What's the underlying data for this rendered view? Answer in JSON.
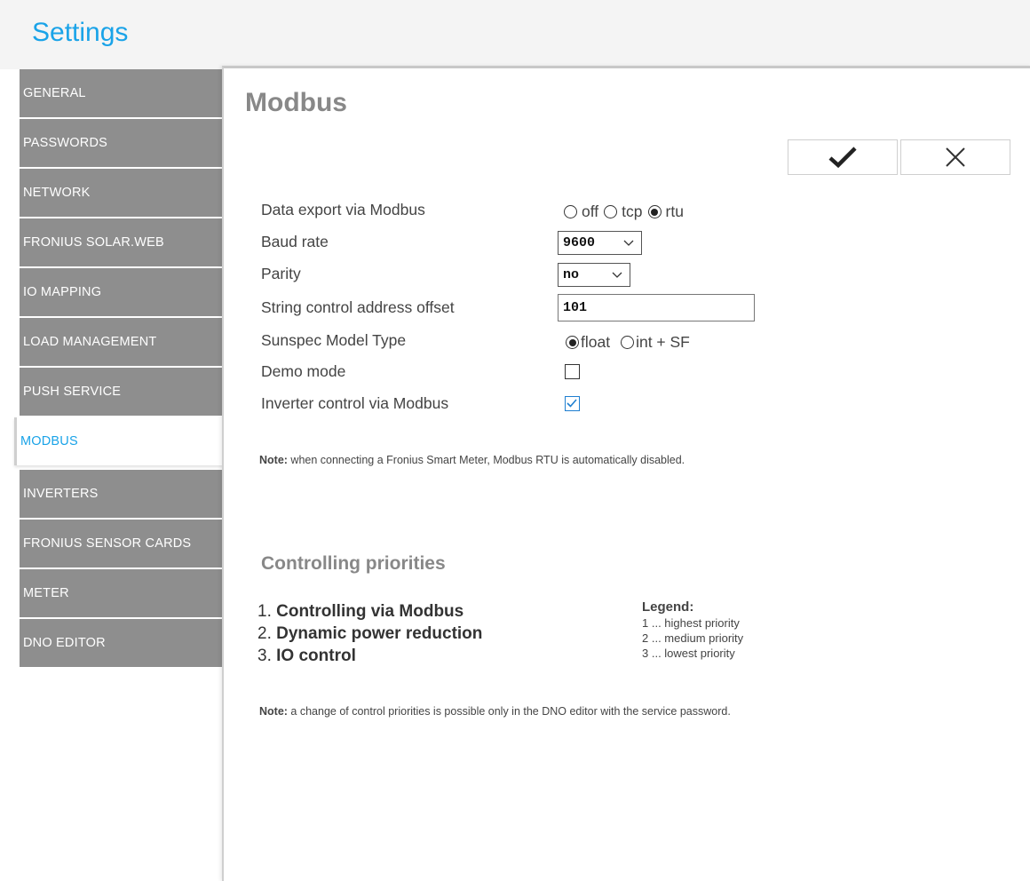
{
  "app": {
    "title": "Settings"
  },
  "sidebar": {
    "items": [
      {
        "label": "GENERAL"
      },
      {
        "label": "PASSWORDS"
      },
      {
        "label": "NETWORK"
      },
      {
        "label": "FRONIUS SOLAR.WEB"
      },
      {
        "label": "IO MAPPING"
      },
      {
        "label": "LOAD MANAGEMENT"
      },
      {
        "label": "PUSH SERVICE"
      },
      {
        "label": "MODBUS"
      },
      {
        "label": "INVERTERS"
      },
      {
        "label": "FRONIUS SENSOR CARDS"
      },
      {
        "label": "METER"
      },
      {
        "label": "DNO EDITOR"
      }
    ],
    "active": "MODBUS"
  },
  "page": {
    "title": "Modbus",
    "actions": {
      "save_icon": "checkmark-icon",
      "cancel_icon": "close-icon"
    }
  },
  "form": {
    "data_export": {
      "label": "Data export via Modbus",
      "options": [
        "off",
        "tcp",
        "rtu"
      ],
      "selected": "rtu"
    },
    "baud_rate": {
      "label": "Baud rate",
      "value": "9600"
    },
    "parity": {
      "label": "Parity",
      "value": "no"
    },
    "string_offset": {
      "label": "String control address offset",
      "value": "101"
    },
    "sunspec": {
      "label": "Sunspec Model Type",
      "options": [
        "float",
        "int + SF"
      ],
      "selected": "float"
    },
    "demo_mode": {
      "label": "Demo mode",
      "checked": false
    },
    "inverter_control": {
      "label": "Inverter control via Modbus",
      "checked": true
    }
  },
  "note1": {
    "bold": "Note:",
    "text": " when connecting a Fronius Smart Meter, Modbus RTU is automatically disabled."
  },
  "priorities": {
    "title": "Controlling priorities",
    "items": [
      {
        "num": "1. ",
        "text": "Controlling via Modbus"
      },
      {
        "num": "2. ",
        "text": "Dynamic power reduction"
      },
      {
        "num": "3. ",
        "text": "IO control"
      }
    ],
    "legend": {
      "title": "Legend:",
      "items": [
        "1 ... highest priority",
        "2 ... medium priority",
        "3 ... lowest priority"
      ]
    }
  },
  "note2": {
    "bold": "Note:",
    "text": " a change of control priorities is possible only in the DNO editor with the service password."
  },
  "colors": {
    "accent": "#1aa3e8",
    "nav_bg": "#8e8e8e",
    "check_color": "#1e7fd0"
  }
}
